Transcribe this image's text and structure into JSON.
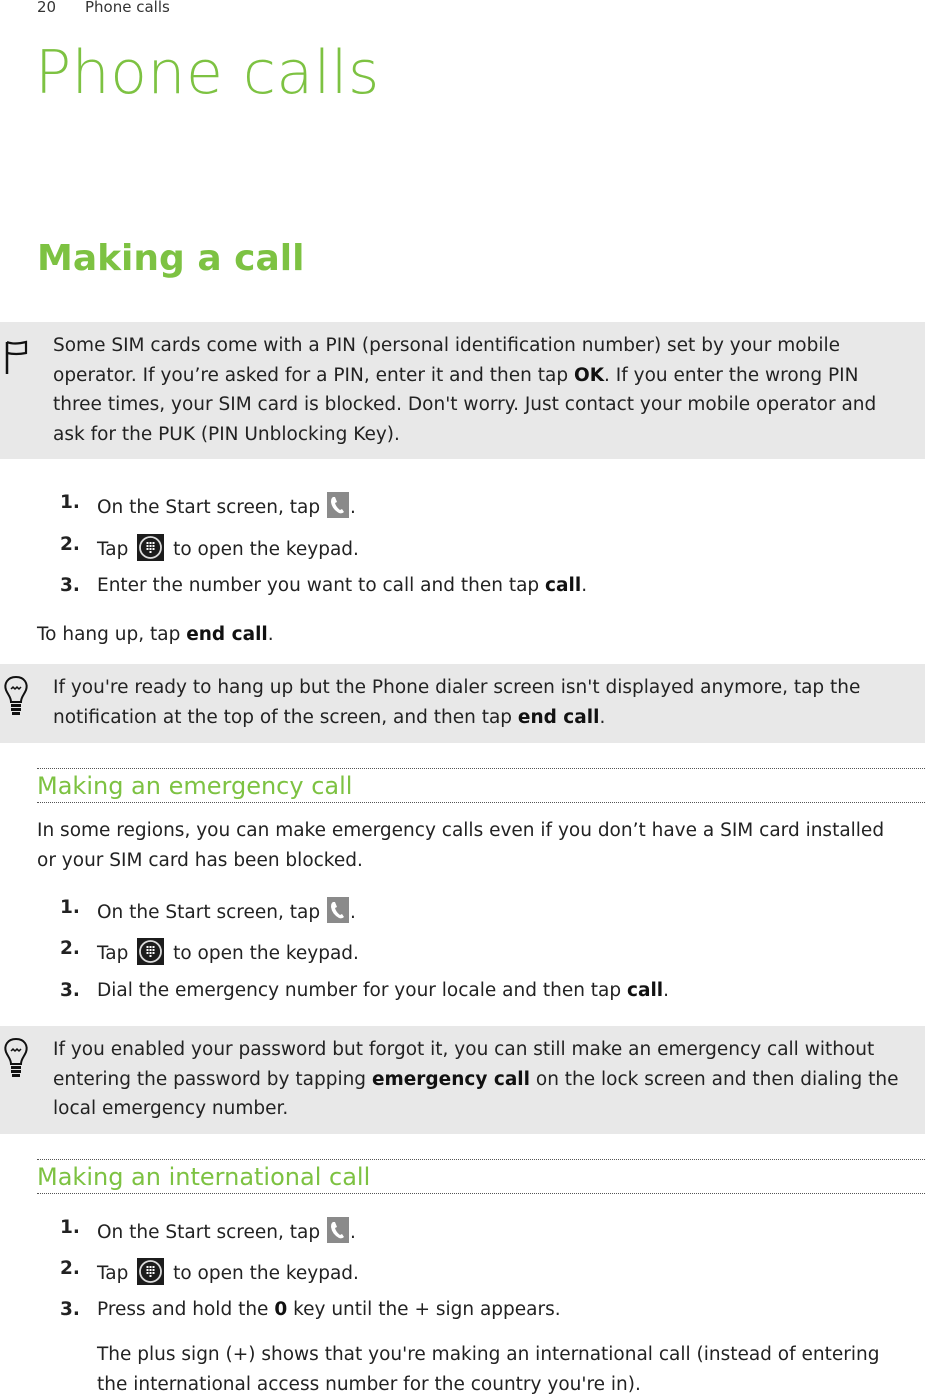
{
  "header": {
    "page_number": "20",
    "section": "Phone calls"
  },
  "chapter_title": "Phone calls",
  "making_a_call": {
    "heading": "Making a call",
    "note": {
      "icon": "flag-icon",
      "t1": "Some SIM cards come with a PIN (personal identification number) set by your mobile operator. If you’re asked for a PIN, enter it and then tap ",
      "b1": "OK",
      "t2": ". If you enter the wrong PIN three times, your SIM card is blocked. Don't worry. Just contact your mobile operator and ask for the PUK (PIN Unblocking Key)."
    },
    "steps": [
      {
        "num": "1.",
        "t1": "On the Start screen, tap ",
        "icon": "phone-icon",
        "t2": "."
      },
      {
        "num": "2.",
        "t1": "Tap ",
        "icon": "keypad-icon",
        "t2": " to open the keypad."
      },
      {
        "num": "3.",
        "t1": "Enter the number you want to call and then tap ",
        "b": "call",
        "t2": "."
      }
    ],
    "hangup": {
      "t1": "To hang up, tap ",
      "b": "end call",
      "t2": "."
    },
    "tip": {
      "icon": "lightbulb-icon",
      "t1": "If you're ready to hang up but the Phone dialer screen isn't displayed anymore, tap the notification at the top of the screen, and then tap ",
      "b": "end call",
      "t2": "."
    }
  },
  "emergency": {
    "heading": "Making an emergency call",
    "intro": "In some regions, you can make emergency calls even if you don’t have a SIM card installed or your SIM card has been blocked.",
    "steps": [
      {
        "num": "1.",
        "t1": "On the Start screen, tap ",
        "icon": "phone-icon",
        "t2": "."
      },
      {
        "num": "2.",
        "t1": "Tap ",
        "icon": "keypad-icon",
        "t2": " to open the keypad."
      },
      {
        "num": "3.",
        "t1": "Dial the emergency number for your locale and then tap ",
        "b": "call",
        "t2": "."
      }
    ],
    "tip": {
      "icon": "lightbulb-icon",
      "t1": "If you enabled your password but forgot it, you can still make an emergency call without entering the password by tapping ",
      "b": "emergency call",
      "t2": " on the lock screen and then dialing the local emergency number."
    }
  },
  "international": {
    "heading": "Making an international call",
    "steps": [
      {
        "num": "1.",
        "t1": "On the Start screen, tap ",
        "icon": "phone-icon",
        "t2": "."
      },
      {
        "num": "2.",
        "t1": "Tap ",
        "icon": "keypad-icon",
        "t2": " to open the keypad."
      },
      {
        "num": "3.",
        "t1": "Press and hold the ",
        "b": "0",
        "t2": " key until the + sign appears."
      }
    ],
    "followup": "The plus sign (+) shows that you're making an international call (instead of entering the international access number for the country you're in)."
  },
  "colors": {
    "accent_green": "#7dc242",
    "note_background": "#e8e8e8"
  }
}
